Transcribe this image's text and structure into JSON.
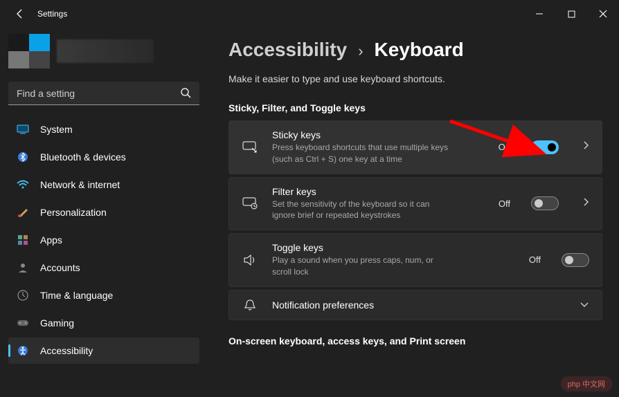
{
  "app": {
    "title": "Settings"
  },
  "search": {
    "placeholder": "Find a setting"
  },
  "sidebar": {
    "items": [
      {
        "label": "System"
      },
      {
        "label": "Bluetooth & devices"
      },
      {
        "label": "Network & internet"
      },
      {
        "label": "Personalization"
      },
      {
        "label": "Apps"
      },
      {
        "label": "Accounts"
      },
      {
        "label": "Time & language"
      },
      {
        "label": "Gaming"
      },
      {
        "label": "Accessibility"
      }
    ]
  },
  "breadcrumb": {
    "parent": "Accessibility",
    "sep": "›",
    "current": "Keyboard"
  },
  "page_desc": "Make it easier to type and use keyboard shortcuts.",
  "section1_title": "Sticky, Filter, and Toggle keys",
  "cards": [
    {
      "title": "Sticky keys",
      "desc": "Press keyboard shortcuts that use multiple keys (such as Ctrl + S) one key at a time",
      "state": "On"
    },
    {
      "title": "Filter keys",
      "desc": "Set the sensitivity of the keyboard so it can ignore brief or repeated keystrokes",
      "state": "Off"
    },
    {
      "title": "Toggle keys",
      "desc": "Play a sound when you press caps, num, or scroll lock",
      "state": "Off"
    },
    {
      "title": "Notification preferences",
      "desc": ""
    }
  ],
  "section2_title": "On-screen keyboard, access keys, and Print screen",
  "watermark": "php 中文网"
}
